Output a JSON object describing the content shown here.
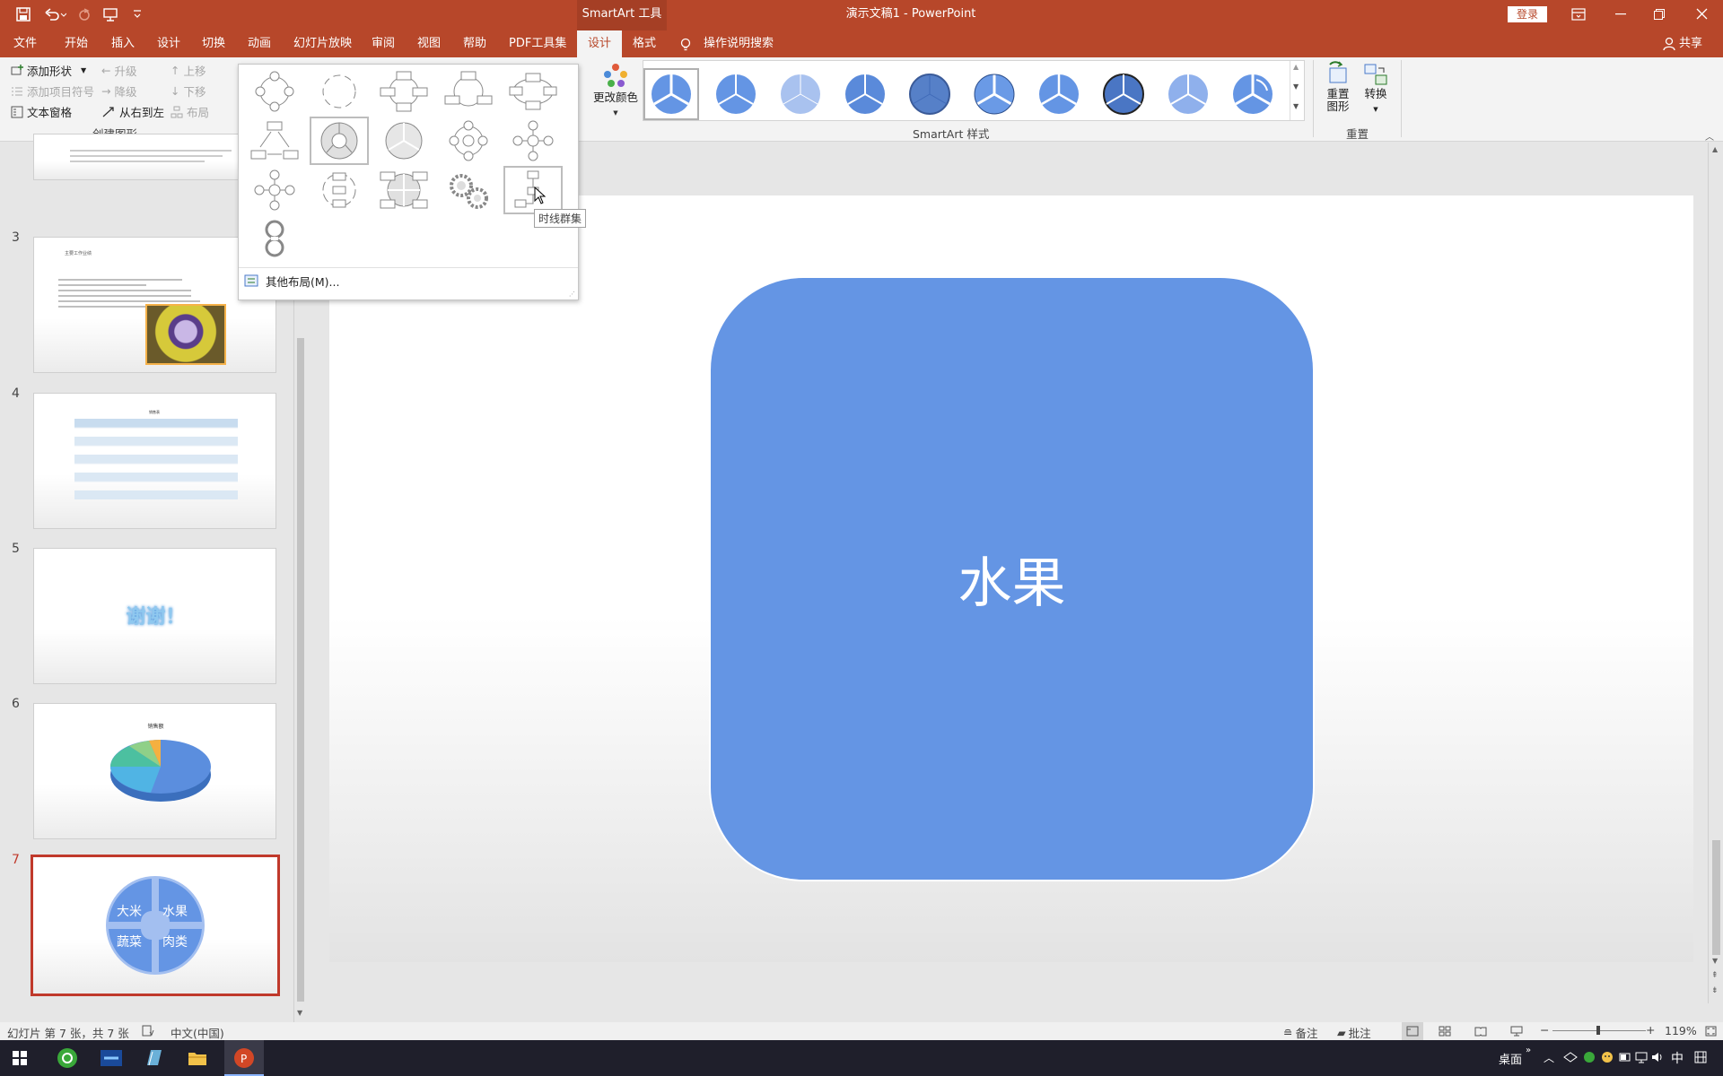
{
  "title_bar": {
    "contextual_tab": "SmartArt 工具",
    "document_title": "演示文稿1 - PowerPoint",
    "login_button": "登录"
  },
  "menu": {
    "items": [
      "文件",
      "开始",
      "插入",
      "设计",
      "切换",
      "动画",
      "幻灯片放映",
      "审阅",
      "视图",
      "帮助",
      "PDF工具集",
      "设计",
      "格式"
    ],
    "search_label": "操作说明搜索",
    "share_label": "共享"
  },
  "ribbon": {
    "create": {
      "add_shape": "添加形状",
      "add_bullet": "添加项目符号",
      "text_pane": "文本窗格",
      "promote": "升级",
      "demote": "降级",
      "right_to_left": "从右到左",
      "move_up": "上移",
      "move_down": "下移",
      "layout": "布局",
      "group_label": "创建图形"
    },
    "change_colors": "更改颜色",
    "styles_group_label": "SmartArt 样式",
    "reset_graphic": "重置图形",
    "convert": "转换",
    "reset_group_label": "重置"
  },
  "layout_gallery": {
    "tooltip": "时线群集",
    "more_layouts": "其他布局(M)..."
  },
  "slides": [
    {
      "number": "3",
      "title": "主要工作业绩"
    },
    {
      "number": "4",
      "title": "销售表"
    },
    {
      "number": "5",
      "title": "谢谢！"
    },
    {
      "number": "6",
      "title": "销售额"
    },
    {
      "number": "7",
      "cells": [
        "大米",
        "水果",
        "蔬菜",
        "肉类"
      ]
    }
  ],
  "slide_canvas": {
    "shape_text": "水果"
  },
  "status": {
    "slide_info": "幻灯片 第 7 张，共 7 张",
    "language": "中文(中国)",
    "notes": "备注",
    "comments": "批注",
    "zoom": "119%"
  },
  "taskbar": {
    "desktop_label": "桌面",
    "ime": "中"
  },
  "colors": {
    "accent": "#b7472a",
    "shape_fill": "#6495e4",
    "selected_thumb_border": "#c0392b"
  }
}
